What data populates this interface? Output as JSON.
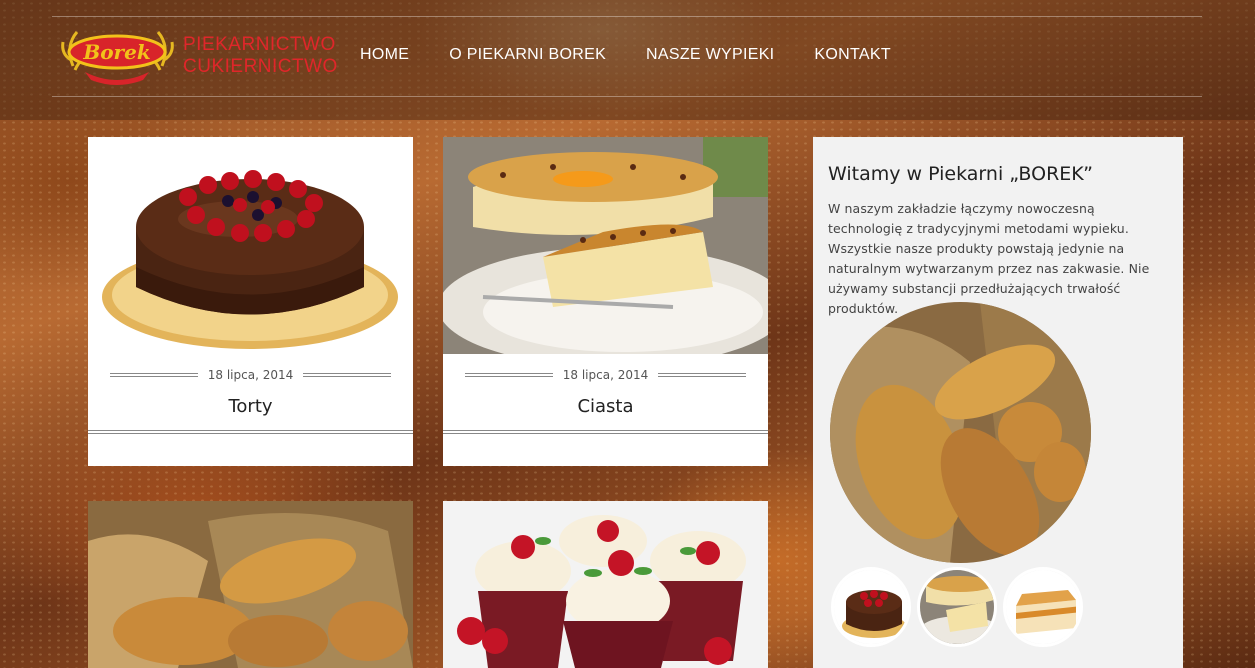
{
  "brand": {
    "logo_text": "Borek",
    "line1": "PIEKARNICTWO",
    "line2": "CUKIERNICTWO",
    "logo_color": "#e0262a",
    "logo_accent": "#f2c21a"
  },
  "nav": {
    "items": [
      {
        "label": "HOME"
      },
      {
        "label": "O PIEKARNI BOREK"
      },
      {
        "label": "NASZE WYPIEKI"
      },
      {
        "label": "KONTAKT"
      }
    ]
  },
  "posts": [
    {
      "date": "18 lipca, 2014",
      "title": "Torty",
      "image": "chocolate-cake"
    },
    {
      "date": "18 lipca, 2014",
      "title": "Ciasta",
      "image": "cheesecake"
    },
    {
      "image": "bread-basket"
    },
    {
      "image": "cupcakes"
    }
  ],
  "sidebar": {
    "heading": "Witamy w Piekarni „BOREK”",
    "body": "W naszym zakładzie łączymy nowoczesną technologię z tradycyjnymi metodami wypieku. Wszystkie nasze produkty powstają jedynie na naturalnym wytwarzanym przez nas zakwasie. Nie używamy substancji przedłużających trwałość produktów.",
    "main_image": "bread-loaves",
    "thumbnails": [
      "chocolate-cake",
      "cheesecake",
      "layered-cake"
    ]
  }
}
